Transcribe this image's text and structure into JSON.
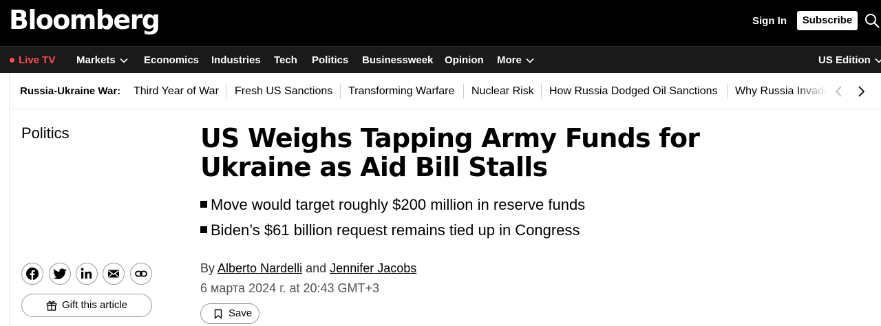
{
  "header": {
    "logo": "Bloomberg",
    "sign_in": "Sign In",
    "subscribe": "Subscribe",
    "search_icon": "search-icon"
  },
  "nav": {
    "live_tv": "Live TV",
    "items": [
      {
        "label": "Markets",
        "dropdown": true
      },
      {
        "label": "Economics",
        "dropdown": false
      },
      {
        "label": "Industries",
        "dropdown": false
      },
      {
        "label": "Tech",
        "dropdown": false
      },
      {
        "label": "Politics",
        "dropdown": false
      },
      {
        "label": "Businessweek",
        "dropdown": false
      },
      {
        "label": "Opinion",
        "dropdown": false
      },
      {
        "label": "More",
        "dropdown": true
      }
    ],
    "edition": "US Edition"
  },
  "topics": {
    "heading": "Russia-Ukraine War:",
    "items": [
      "Third Year of War",
      "Fresh US Sanctions",
      "Transforming Warfare",
      "Nuclear Risk",
      "How Russia Dodged Oil Sanctions",
      "Why Russia Invade"
    ]
  },
  "article": {
    "section": "Politics",
    "headline": "US Weighs Tapping Army Funds for Ukraine as Aid Bill Stalls",
    "bullets": [
      "Move would target roughly $200 million in reserve funds",
      "Biden’s $61 billion request remains tied up in Congress"
    ],
    "byline": {
      "prefix": "By",
      "author1": "Alberto Nardelli",
      "conj": "and",
      "author2": "Jennifer Jacobs"
    },
    "date": "6 марта 2024 г. at 20:43 GMT+3",
    "save_label": "Save"
  },
  "share": {
    "icons": [
      "facebook-icon",
      "twitter-icon",
      "linkedin-icon",
      "email-icon",
      "link-icon"
    ],
    "gift_label": "Gift this article"
  },
  "colors": {
    "masthead_bg": "#000000",
    "nav_bg": "#1a1a1a",
    "live_red": "#ff4d4d"
  }
}
